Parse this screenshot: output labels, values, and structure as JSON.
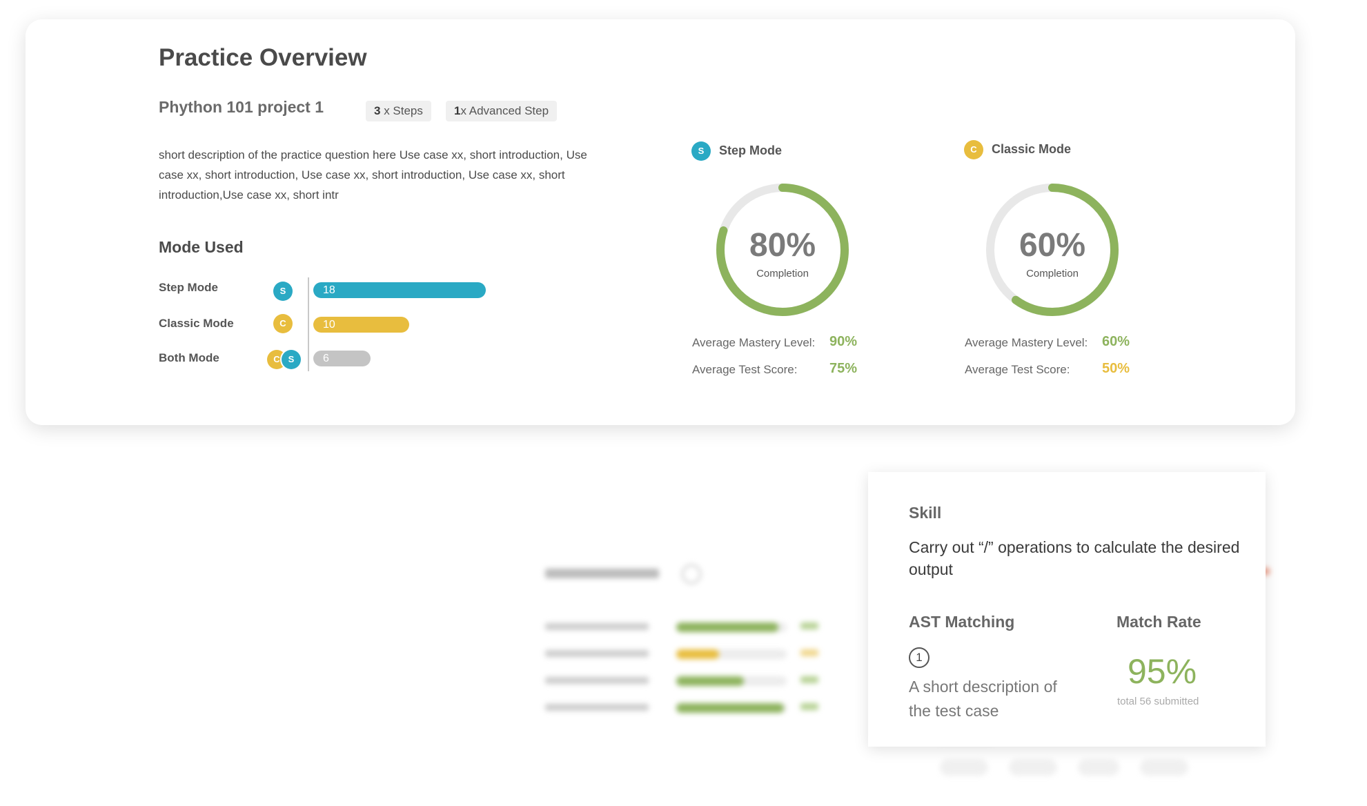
{
  "overview": {
    "title": "Practice Overview",
    "project_name": "Phython 101 project 1",
    "chips": [
      {
        "count": "3",
        "text": " x Steps"
      },
      {
        "count": "1",
        "text": "x Advanced Step"
      }
    ],
    "description": "short description of the practice question here Use case xx, short introduction, Use case xx, short introduction, Use case xx, short introduction, Use case xx, short introduction,Use case xx, short intr"
  },
  "mode_used": {
    "title": "Mode Used",
    "rows": [
      {
        "label": "Step Mode",
        "badges": [
          "S"
        ],
        "value": 18,
        "color": "#2aa9c4"
      },
      {
        "label": "Classic Mode",
        "badges": [
          "C"
        ],
        "value": 10,
        "color": "#e8bd3e"
      },
      {
        "label": "Both Mode",
        "badges": [
          "C",
          "S"
        ],
        "value": 6,
        "color": "#c4c4c4"
      }
    ],
    "max_value": 18
  },
  "modes": [
    {
      "badge": "S",
      "name": "Step Mode",
      "completion": 80,
      "completion_text": "80%",
      "completion_label": "Completion",
      "mastery_label": "Average Mastery Level:",
      "mastery_value": "90%",
      "test_label": "Average Test Score:",
      "test_value": "75%"
    },
    {
      "badge": "C",
      "name": "Classic Mode",
      "completion": 60,
      "completion_text": "60%",
      "completion_label": "Completion",
      "mastery_label": "Average Mastery Level:",
      "mastery_value": "60%",
      "test_label": "Average Test Score:",
      "test_value": "50%"
    }
  ],
  "skill_popup": {
    "skill_heading": "Skill",
    "skill_text": "Carry out “/” operations to calculate the desired output",
    "ast_heading": "AST Matching",
    "ast_number": "1",
    "ast_text": "A short description of the test case",
    "rate_heading": "Match Rate",
    "rate_value": "95%",
    "rate_sub": "total 56 submitted"
  },
  "colors": {
    "step": "#2aa9c4",
    "classic": "#e8bd3e",
    "good": "#8db35d",
    "track": "#e8e8e8"
  }
}
